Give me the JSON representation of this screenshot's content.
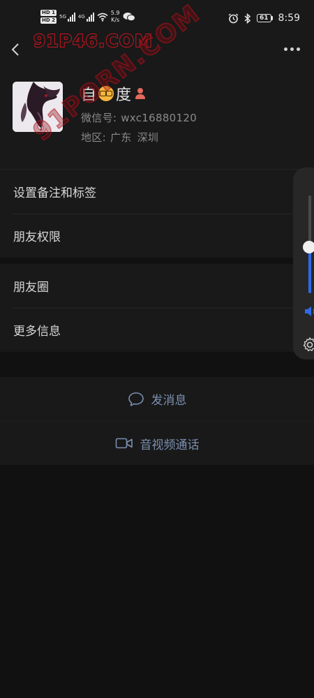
{
  "watermark": {
    "top_text": "91P46.COM",
    "diagonal_text": "91PORN.COM"
  },
  "status_bar": {
    "hd1": "HD",
    "hd1_index": "1",
    "hd2": "HD",
    "hd2_index": "2",
    "net1": "5G",
    "net2": "4G",
    "speed_value": "5.9",
    "speed_unit": "K/s",
    "battery": "61",
    "time": "8:59",
    "icons": [
      "signal-icon",
      "wifi-icon",
      "wechat-icon",
      "alarm-icon",
      "bluetooth-icon",
      "battery-icon"
    ]
  },
  "nav": {
    "back_icon": "chevron-left-icon",
    "more_icon": "more-dots-icon"
  },
  "profile": {
    "name_part1": "自",
    "name_part2": "度",
    "name_emojis": [
      "nerd-face-emoji",
      "person-emoji"
    ],
    "wechat_id_label": "微信号:",
    "wechat_id": "wxc16880120",
    "region_label": "地区:",
    "province": "广东",
    "city": "深圳"
  },
  "menu_group1": {
    "remark": "设置备注和标签",
    "permissions": "朋友权限"
  },
  "menu_group2": {
    "moments": "朋友圈",
    "more_info": "更多信息"
  },
  "actions": {
    "send_message": "发消息",
    "av_call": "音视频通话"
  },
  "volume_overlay": {
    "level_fraction": 0.47,
    "icons": [
      "speaker-icon",
      "settings-gear-icon"
    ]
  },
  "colors": {
    "background": "#111111",
    "surface": "#191919",
    "action_text": "#7b8fb0",
    "volume_accent": "#2f6be8",
    "watermark_red": "#c8141f"
  }
}
